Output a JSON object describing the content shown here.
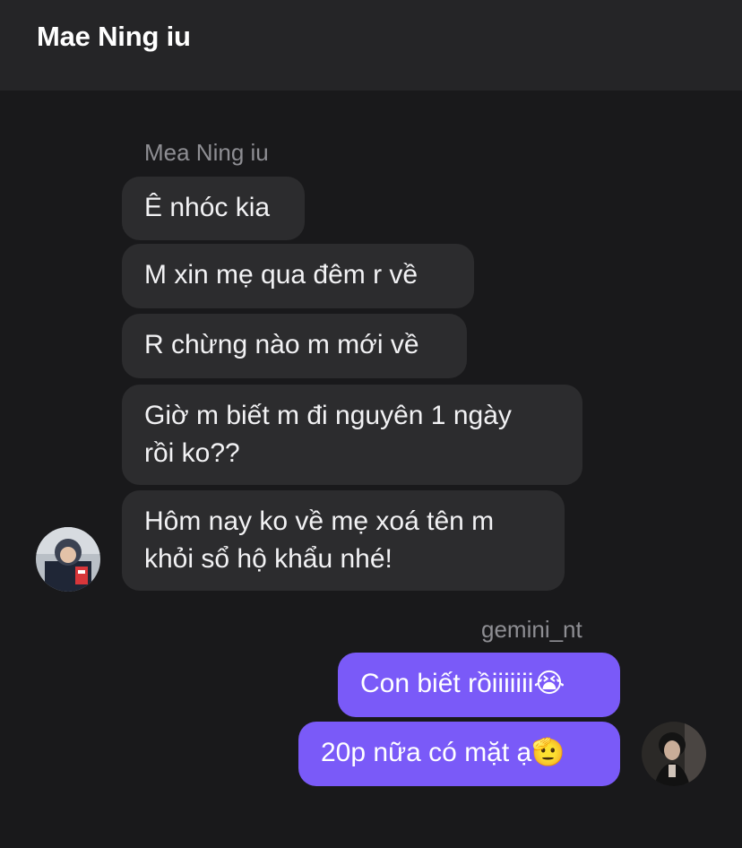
{
  "header": {
    "title": "Mae Ning iu"
  },
  "incoming": {
    "sender": "Mea Ning iu",
    "messages": [
      {
        "line1": "Ê nhóc kia"
      },
      {
        "line1": "M xin mẹ qua đêm r về"
      },
      {
        "line1": "R chừng nào m mới về"
      },
      {
        "line1": "Giờ m biết m đi nguyên 1 ngày",
        "line2": "rồi ko??"
      },
      {
        "line1": "Hôm nay ko về mẹ xoá tên m",
        "line2": "khỏi sổ hộ khẩu nhé!"
      }
    ]
  },
  "outgoing": {
    "sender": "gemini_nt",
    "messages": [
      {
        "line1": "Con biết rồiiiiiii😭"
      },
      {
        "line1": "20p nữa có mặt ạ🫡"
      }
    ]
  },
  "colors": {
    "background": "#19191b",
    "header": "#252527",
    "incoming_bubble": "#2c2c2e",
    "outgoing_bubble": "#7a5af8",
    "sender_text": "#8e8e93"
  }
}
